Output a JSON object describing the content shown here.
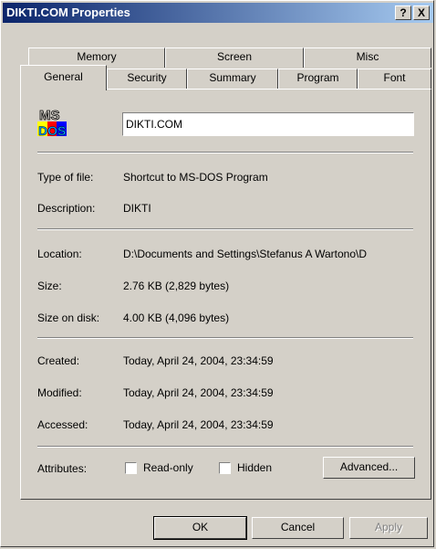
{
  "window": {
    "title": "DIKTI.COM Properties"
  },
  "titlebar_buttons": {
    "help": "?",
    "close": "X"
  },
  "tabs_back": [
    "Memory",
    "Screen",
    "Misc"
  ],
  "tabs_front": [
    "General",
    "Security",
    "Summary",
    "Program",
    "Font"
  ],
  "general": {
    "file_name": "DIKTI.COM",
    "rows": [
      {
        "label": "Type of file:",
        "value": "Shortcut to MS-DOS Program"
      },
      {
        "label": "Description:",
        "value": "DIKTI"
      },
      {
        "label": "Location:",
        "value": "D:\\Documents and Settings\\Stefanus A Wartono\\D"
      },
      {
        "label": "Size:",
        "value": "2.76 KB (2,829 bytes)"
      },
      {
        "label": "Size on disk:",
        "value": "4.00 KB (4,096 bytes)"
      },
      {
        "label": "Created:",
        "value": "Today, April 24, 2004, 23:34:59"
      },
      {
        "label": "Modified:",
        "value": "Today, April 24, 2004, 23:34:59"
      },
      {
        "label": "Accessed:",
        "value": "Today, April 24, 2004, 23:34:59"
      }
    ],
    "attributes_label": "Attributes:",
    "read_only_label": "Read-only",
    "hidden_label": "Hidden",
    "advanced_label": "Advanced...",
    "read_only_checked": false,
    "hidden_checked": false
  },
  "buttons": {
    "ok": "OK",
    "cancel": "Cancel",
    "apply": "Apply"
  },
  "icon": {
    "name": "ms-dos-icon",
    "text_top": "MS",
    "text_bottom": "DOS"
  }
}
